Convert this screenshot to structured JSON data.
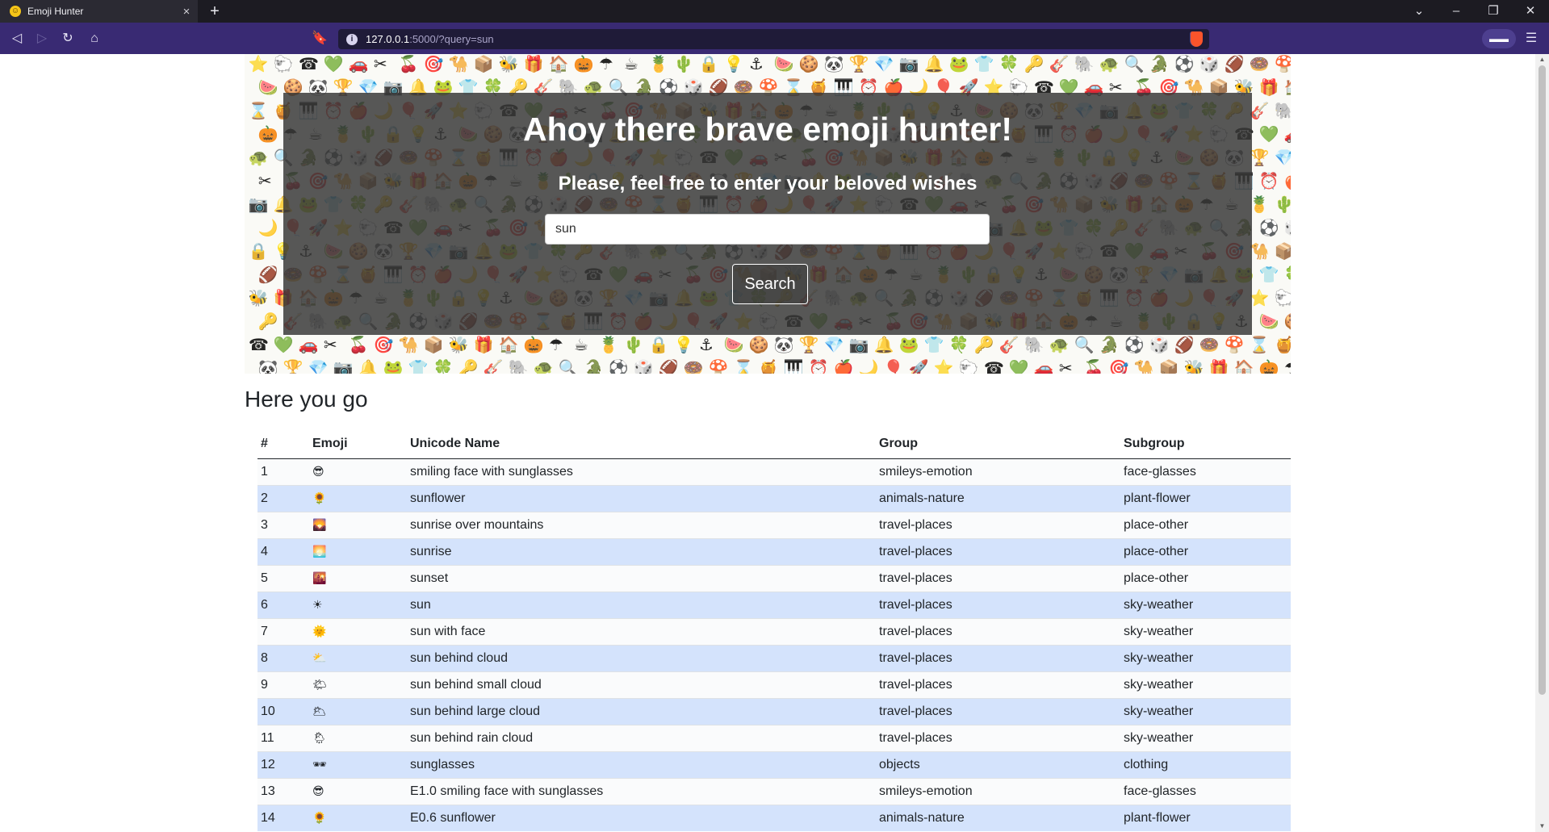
{
  "browser": {
    "tab_title": "Emoji Hunter",
    "tab_close": "×",
    "new_tab": "+",
    "url_host": "127.0.0.1",
    "url_path": ":5000/?query=sun",
    "icons": [
      "back-icon",
      "forward-icon",
      "reload-icon",
      "home-icon",
      "bookmark-icon",
      "info-icon",
      "brave-shield-icon",
      "menu-icon"
    ]
  },
  "hero": {
    "heading": "Ahoy there brave emoji hunter!",
    "subheading": "Please, feel free to enter your beloved wishes",
    "search_value": "sun",
    "search_button": "Search"
  },
  "results": {
    "title": "Here you go",
    "columns": [
      "#",
      "Emoji",
      "Unicode Name",
      "Group",
      "Subgroup"
    ],
    "rows": [
      {
        "num": "1",
        "emoji": "😎",
        "name": "smiling face with sunglasses",
        "group": "smileys-emotion",
        "subgroup": "face-glasses"
      },
      {
        "num": "2",
        "emoji": "🌻",
        "name": "sunflower",
        "group": "animals-nature",
        "subgroup": "plant-flower"
      },
      {
        "num": "3",
        "emoji": "🌄",
        "name": "sunrise over mountains",
        "group": "travel-places",
        "subgroup": "place-other"
      },
      {
        "num": "4",
        "emoji": "🌅",
        "name": "sunrise",
        "group": "travel-places",
        "subgroup": "place-other"
      },
      {
        "num": "5",
        "emoji": "🌇",
        "name": "sunset",
        "group": "travel-places",
        "subgroup": "place-other"
      },
      {
        "num": "6",
        "emoji": "☀",
        "name": "sun",
        "group": "travel-places",
        "subgroup": "sky-weather"
      },
      {
        "num": "7",
        "emoji": "🌞",
        "name": "sun with face",
        "group": "travel-places",
        "subgroup": "sky-weather"
      },
      {
        "num": "8",
        "emoji": "⛅",
        "name": "sun behind cloud",
        "group": "travel-places",
        "subgroup": "sky-weather"
      },
      {
        "num": "9",
        "emoji": "🌤",
        "name": "sun behind small cloud",
        "group": "travel-places",
        "subgroup": "sky-weather"
      },
      {
        "num": "10",
        "emoji": "🌥",
        "name": "sun behind large cloud",
        "group": "travel-places",
        "subgroup": "sky-weather"
      },
      {
        "num": "11",
        "emoji": "🌦",
        "name": "sun behind rain cloud",
        "group": "travel-places",
        "subgroup": "sky-weather"
      },
      {
        "num": "12",
        "emoji": "🕶",
        "name": "sunglasses",
        "group": "objects",
        "subgroup": "clothing"
      },
      {
        "num": "13",
        "emoji": "😎",
        "name": "E1.0 smiling face with sunglasses",
        "group": "smileys-emotion",
        "subgroup": "face-glasses"
      },
      {
        "num": "14",
        "emoji": "🌻",
        "name": "E0.6 sunflower",
        "group": "animals-nature",
        "subgroup": "plant-flower"
      }
    ]
  },
  "colors": {
    "tab_strip": "#1c1b22",
    "toolbar": "#392a73",
    "row_highlight": "#d4e3fc",
    "overlay": "#373737"
  }
}
